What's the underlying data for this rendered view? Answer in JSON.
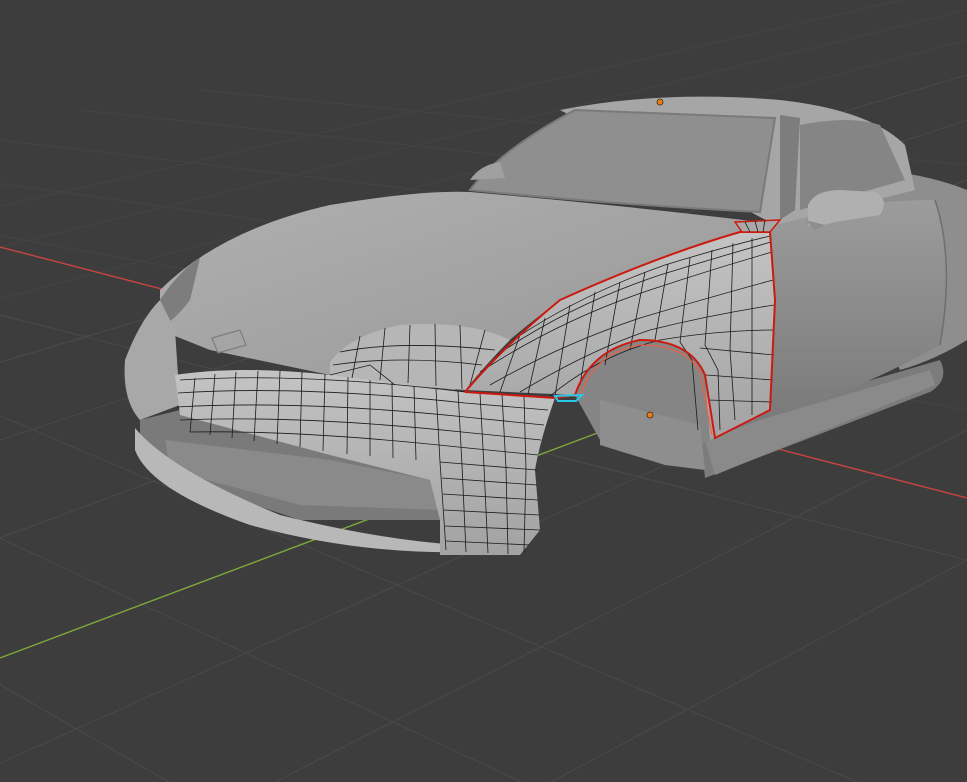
{
  "viewport": {
    "background": "#3d3d3d",
    "grid_color": "#4a4a4a",
    "x_axis_color": "#c8443f",
    "y_axis_color": "#7fa83a"
  },
  "model": {
    "body_color": "#9a9a9a",
    "body_highlight": "#b4b4b4",
    "body_shadow": "#6e6e6e",
    "wireframe_color": "#1a1a1a",
    "selection_outline_color": "#cc1a10",
    "active_edge_color": "#28c8e8",
    "origin_point_color": "#e87d1e"
  }
}
